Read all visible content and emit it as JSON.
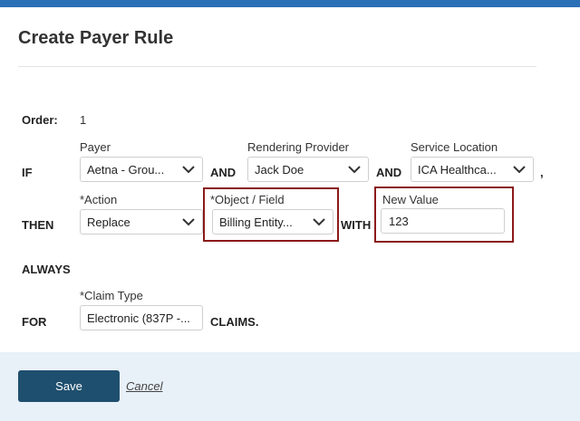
{
  "dialog": {
    "title": "Create Payer Rule"
  },
  "order": {
    "label": "Order:",
    "value": "1"
  },
  "if_row": {
    "keyword": "IF",
    "payer": {
      "label": "Payer",
      "value": "Aetna - Grou..."
    },
    "and1": "AND",
    "rendering_provider": {
      "label": "Rendering Provider",
      "value": "Jack Doe"
    },
    "and2": "AND",
    "service_location": {
      "label": "Service Location",
      "value": "ICA Healthca..."
    },
    "comma": ","
  },
  "then_row": {
    "keyword": "THEN",
    "action": {
      "label": "*Action",
      "value": "Replace"
    },
    "object_field": {
      "label": "*Object / Field",
      "value": "Billing Entity..."
    },
    "with": "WITH",
    "new_value": {
      "label": "New Value",
      "value": "123"
    }
  },
  "always": "ALWAYS",
  "for_row": {
    "keyword": "FOR",
    "claim_type": {
      "label": "*Claim Type",
      "value": "Electronic (837P -..."
    },
    "suffix": "CLAIMS."
  },
  "footer": {
    "save_label": "Save",
    "cancel_label": "Cancel"
  },
  "colors": {
    "top_bar": "#2b6fb6",
    "primary_button": "#1f4f6e",
    "highlight_border": "#8b1a1a",
    "footer_bg": "#e8f0f8"
  },
  "icons": {
    "dropdown": "chevron-down-icon"
  }
}
